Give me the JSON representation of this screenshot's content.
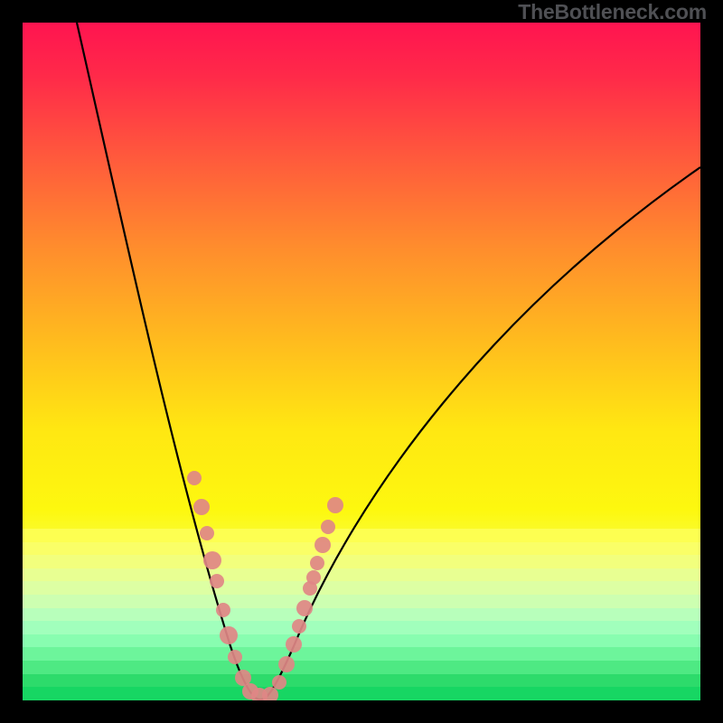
{
  "watermark": "TheBottleneck.com",
  "chart_data": {
    "type": "line",
    "title": "",
    "xlabel": "",
    "ylabel": "",
    "xlim": [
      0,
      100
    ],
    "ylim": [
      0,
      100
    ],
    "background_gradient": "red-yellow-green (top to bottom)",
    "series": [
      {
        "name": "bottleneck-curve",
        "color": "#000000",
        "x": [
          8,
          12,
          16,
          20,
          24,
          28,
          30,
          32,
          33,
          34,
          35,
          36,
          38,
          42,
          46,
          50,
          56,
          64,
          72,
          80,
          90,
          100
        ],
        "y": [
          100,
          83,
          67,
          52,
          37,
          22,
          14,
          7,
          3,
          0,
          0,
          2,
          7,
          16,
          25,
          33,
          42,
          52,
          60,
          66,
          73,
          79
        ]
      }
    ],
    "markers": [
      {
        "name": "data-points",
        "color": "#e08785",
        "shape": "circle",
        "x": [
          25,
          26.2,
          27.5,
          28.2,
          29.0,
          30.5,
          31.0,
          32.0,
          33.0,
          34.0,
          35.0,
          36.0,
          38.5,
          39.2,
          40.0,
          41.2,
          42.0,
          42.8,
          43.5,
          44.5
        ],
        "y": [
          33,
          28,
          22,
          19,
          15,
          9,
          7,
          3.5,
          1.2,
          0,
          0,
          1.5,
          8,
          10,
          13,
          16,
          19,
          22,
          24,
          28
        ]
      }
    ],
    "band_boundaries_pct_from_bottom": [
      0,
      1.5,
      3.0,
      4.8,
      6.6,
      8.6,
      10.6,
      12.8,
      15.2,
      17.8,
      20.6,
      23.6,
      25.2
    ]
  },
  "colors": {
    "marker": "#e08785",
    "curve": "#000000",
    "frame": "#000000"
  }
}
